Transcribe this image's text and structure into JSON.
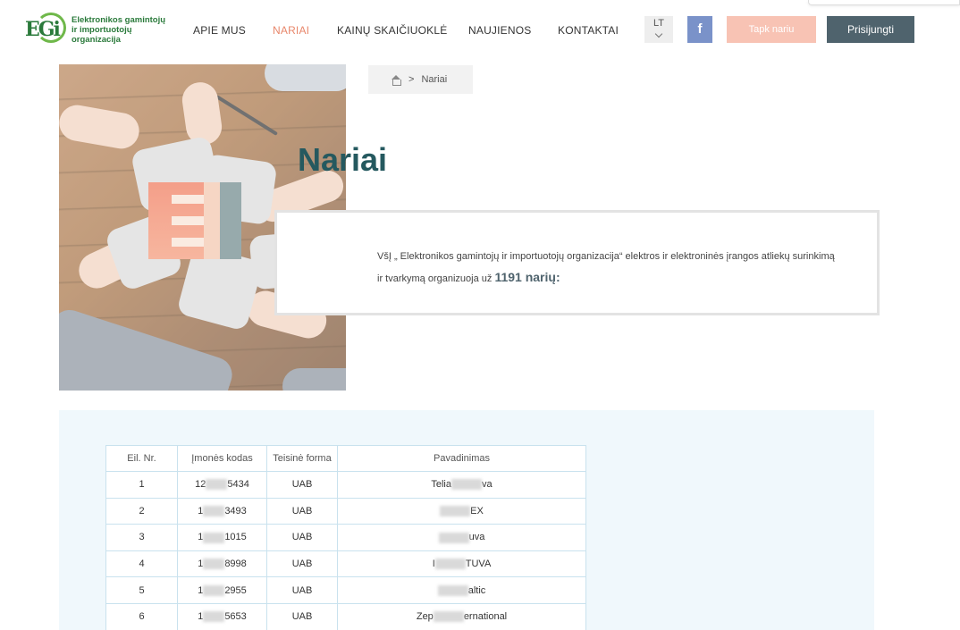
{
  "header": {
    "logo_text": "Elektronikos gamintojų ir importuotojų organizacija",
    "logo_letters": "EGi",
    "nav": [
      {
        "label": "APIE MUS",
        "active": false
      },
      {
        "label": "NARIAI",
        "active": true
      },
      {
        "label": "KAINŲ SKAIČIUOKLĖ",
        "active": false
      },
      {
        "label": "NAUJIENOS",
        "active": false
      },
      {
        "label": "KONTAKTAI",
        "active": false
      }
    ],
    "language": "LT",
    "facebook_label": "f",
    "join_button": "Tapk nariu",
    "login_button": "Prisijungti"
  },
  "breadcrumb": {
    "separator": ">",
    "current": "Nariai"
  },
  "page_title": "Nariai",
  "intro": {
    "line1": "VšĮ „ Elektronikos gamintojų ir importuotojų organizacija“ elektros ir elektroninės įrangos atliekų surinkimą",
    "line2_prefix": "ir tvarkymą organizuoja už ",
    "count": "1191 narių:"
  },
  "table": {
    "headers": [
      "Eil. Nr.",
      "Įmonės kodas",
      "Teisinė forma",
      "Pavadinimas"
    ],
    "rows": [
      {
        "nr": "1",
        "code_a": "12",
        "code_b": "5434",
        "form": "UAB",
        "name_a": "Telia",
        "name_b": "va"
      },
      {
        "nr": "2",
        "code_a": "1",
        "code_b": "3493",
        "form": "UAB",
        "name_a": "",
        "name_b": "EX"
      },
      {
        "nr": "3",
        "code_a": "1",
        "code_b": "1015",
        "form": "UAB",
        "name_a": "",
        "name_b": "uva"
      },
      {
        "nr": "4",
        "code_a": "1",
        "code_b": "8998",
        "form": "UAB",
        "name_a": "I",
        "name_b": "TUVA"
      },
      {
        "nr": "5",
        "code_a": "1",
        "code_b": "2955",
        "form": "UAB",
        "name_a": "",
        "name_b": "altic"
      },
      {
        "nr": "6",
        "code_a": "1",
        "code_b": "5653",
        "form": "UAB",
        "name_a": "Zep",
        "name_b": "ernational"
      }
    ]
  },
  "colors": {
    "accent": "#e8876b",
    "title": "#25595f",
    "login_bg": "#4f636d",
    "join_bg": "#f8c3b4",
    "facebook_bg": "#7a92c9",
    "section_bg": "#f0f8fc"
  }
}
